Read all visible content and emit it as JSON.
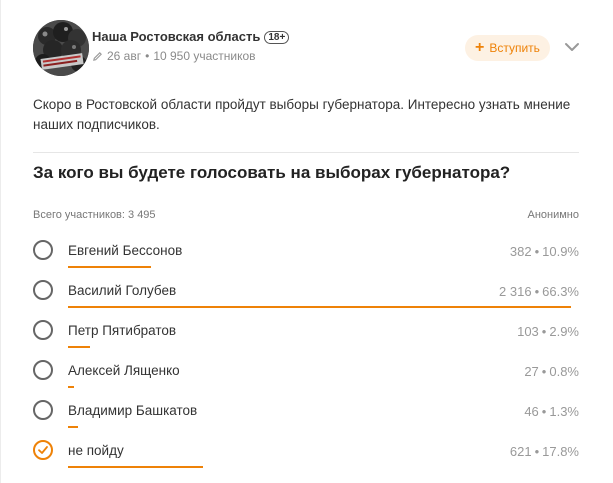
{
  "group": {
    "name": "Наша Ростовская область",
    "badge": "18+",
    "meta_date": "26 авг",
    "meta_members": "10 950 участников"
  },
  "join_button": {
    "label": "Вступить"
  },
  "post": {
    "text": "Скоро в Ростовской области пройдут выборы губернатора. Интересно узнать мнение наших подписчиков."
  },
  "poll": {
    "question": "За кого вы будете голосовать на выборах губернатора?",
    "total_label": "Всего участников: 3 495",
    "anonymous_label": "Анонимно",
    "options": [
      {
        "label": "Евгений Бессонов",
        "votes": "382",
        "percent": "10.9%",
        "share": 10.9,
        "checked": false
      },
      {
        "label": "Василий Голубев",
        "votes": "2 316",
        "percent": "66.3%",
        "share": 66.3,
        "checked": false
      },
      {
        "label": "Петр Пятибратов",
        "votes": "103",
        "percent": "2.9%",
        "share": 2.9,
        "checked": false
      },
      {
        "label": "Алексей Лященко",
        "votes": "27",
        "percent": "0.8%",
        "share": 0.8,
        "checked": false
      },
      {
        "label": "Владимир Башкатов",
        "votes": "46",
        "percent": "1.3%",
        "share": 1.3,
        "checked": false
      },
      {
        "label": "не пойду",
        "votes": "621",
        "percent": "17.8%",
        "share": 17.8,
        "checked": true
      }
    ]
  },
  "colors": {
    "accent": "#ee8208",
    "join_bg": "#fdf1e3"
  },
  "icons": {
    "avatar": "group-avatar",
    "meta": "pencil-icon",
    "join": "plus-icon",
    "menu": "chevron-down-icon",
    "checked": "checkmark-icon"
  }
}
